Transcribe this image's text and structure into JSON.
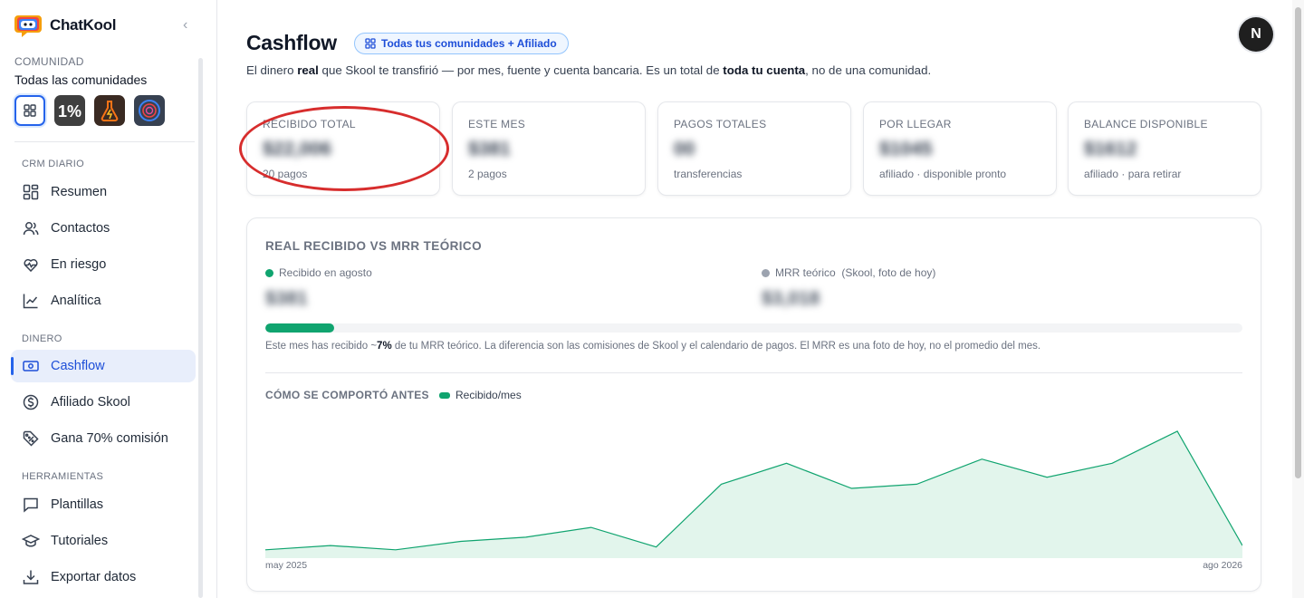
{
  "app": {
    "name": "ChatKool"
  },
  "sidebar": {
    "community_label": "COMUNIDAD",
    "community_name": "Todas las comunidades",
    "communities": [
      {
        "icon": "grid-icon",
        "selected": true
      },
      {
        "icon": "one-percent-logo",
        "selected": false
      },
      {
        "icon": "flask-logo",
        "selected": false
      },
      {
        "icon": "circle-logo",
        "selected": false
      }
    ],
    "sections": [
      {
        "title": "CRM DIARIO",
        "items": [
          "Resumen",
          "Contactos",
          "En riesgo",
          "Analítica"
        ]
      },
      {
        "title": "DINERO",
        "items": [
          "Cashflow",
          "Afiliado Skool",
          "Gana 70% comisión"
        ]
      },
      {
        "title": "HERRAMIENTAS",
        "items": [
          "Plantillas",
          "Tutoriales",
          "Exportar datos"
        ]
      }
    ],
    "active_item": "Cashflow"
  },
  "header": {
    "title": "Cashflow",
    "scope_pill": "Todas tus comunidades + Afiliado",
    "subtitle_1": "El dinero ",
    "subtitle_bold_1": "real",
    "subtitle_2": " que Skool te transfirió — por mes, fuente y cuenta bancaria. Es un total de ",
    "subtitle_bold_2": "toda tu cuenta",
    "subtitle_3": ", no de una comunidad.",
    "avatar_initial": "N"
  },
  "stats": [
    {
      "label": "RECIBIDO TOTAL",
      "value": "$22,006",
      "sub": "20 pagos"
    },
    {
      "label": "ESTE MES",
      "value": "$381",
      "sub": "2 pagos"
    },
    {
      "label": "PAGOS TOTALES",
      "value": "00",
      "sub": "transferencias"
    },
    {
      "label": "POR LLEGAR",
      "value": "$1045",
      "sub": "afiliado · disponible pronto"
    },
    {
      "label": "BALANCE DISPONIBLE",
      "value": "$1612",
      "sub": "afiliado · para retirar"
    }
  ],
  "panel": {
    "title": "REAL RECIBIDO VS MRR TEÓRICO",
    "received_label": "Recibido en agosto",
    "received_value": "$381",
    "mrr_label": "MRR teórico  (Skool, foto de hoy)",
    "mrr_value": "$3,018",
    "progress_fraction": 0.07,
    "note_1": "Este mes has recibido ~",
    "note_bold": "7%",
    "note_2": " de tu MRR teórico. La diferencia son las comisiones de Skool y el calendario de pagos. El MRR es una foto de hoy, no el promedio del mes.",
    "history_title": "CÓMO SE COMPORTÓ ANTES",
    "history_legend": "Recibido/mes",
    "x_start_label": "may 2025",
    "x_end_label": "ago 2026"
  },
  "colors": {
    "accent": "#2563eb",
    "green": "#10a46f",
    "annotation": "#d72d2d"
  },
  "chart_data": {
    "type": "area",
    "x": [
      "may 2025",
      "jun 2025",
      "jul 2025",
      "ago 2025",
      "sep 2025",
      "oct 2025",
      "nov 2025",
      "dic 2025",
      "ene 2026",
      "feb 2026",
      "mar 2026",
      "abr 2026",
      "may 2026",
      "jun 2026",
      "jul 2026",
      "ago 2026"
    ],
    "series": [
      {
        "name": "Recibido/mes",
        "values": [
          6,
          9,
          6,
          12,
          15,
          22,
          8,
          53,
          68,
          50,
          53,
          71,
          58,
          68,
          91,
          9
        ]
      }
    ],
    "ylim": [
      0,
      100
    ],
    "xlabel": "",
    "ylabel": "",
    "grid": false,
    "legend": "top-left"
  }
}
